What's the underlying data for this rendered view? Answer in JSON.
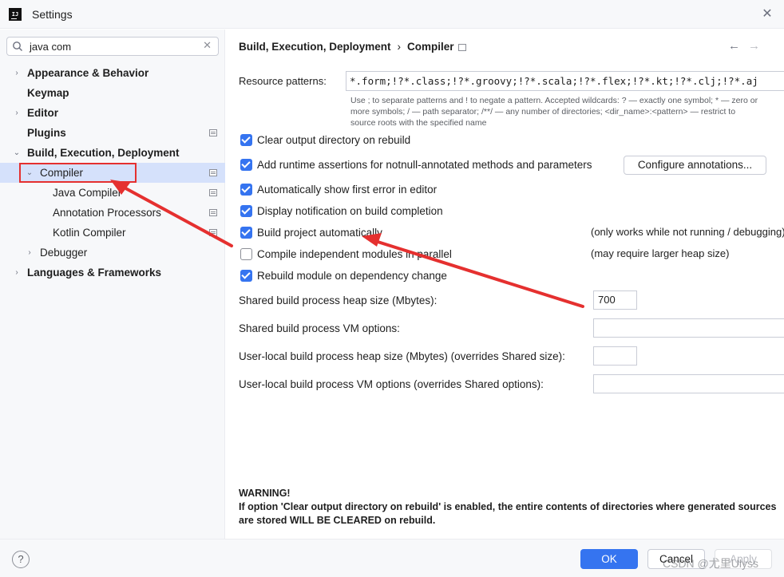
{
  "window": {
    "title": "Settings",
    "app_icon_text": "IJ",
    "close_icon": "close-icon"
  },
  "sidebar": {
    "search_value": "java com",
    "items": [
      {
        "label": "Appearance & Behavior",
        "expandable": true,
        "expanded": false
      },
      {
        "label": "Keymap"
      },
      {
        "label": "Editor",
        "expandable": true,
        "expanded": false
      },
      {
        "label": "Plugins"
      },
      {
        "label": "Build, Execution, Deployment",
        "expandable": true,
        "expanded": true
      },
      {
        "label": "Compiler",
        "expandable": true,
        "expanded": true,
        "selected": true
      },
      {
        "label": "Java Compiler"
      },
      {
        "label": "Annotation Processors"
      },
      {
        "label": "Kotlin Compiler"
      },
      {
        "label": "Debugger",
        "expandable": true,
        "expanded": false
      },
      {
        "label": "Languages & Frameworks",
        "expandable": true,
        "expanded": false
      }
    ]
  },
  "breadcrumb": {
    "parent": "Build, Execution, Deployment",
    "separator": "›",
    "current": "Compiler"
  },
  "resource_patterns": {
    "label": "Resource patterns:",
    "value": "*.form;!?*.class;!?*.groovy;!?*.scala;!?*.flex;!?*.kt;!?*.clj;!?*.aj",
    "hint_line1": "Use ; to separate patterns and ! to negate a pattern. Accepted wildcards: ? — exactly one symbol; * — zero or",
    "hint_line2": "more symbols; / — path separator; /**/ — any number of directories; <dir_name>:<pattern> — restrict to",
    "hint_line3": "source roots with the specified name"
  },
  "options": [
    {
      "label": "Clear output directory on rebuild",
      "checked": true
    },
    {
      "label": "Add runtime assertions for notnull-annotated methods and parameters",
      "checked": true
    },
    {
      "label": "Automatically show first error in editor",
      "checked": true
    },
    {
      "label": "Display notification on build completion",
      "checked": true
    },
    {
      "label": "Build project automatically",
      "checked": true,
      "note": "(only works while not running / debugging)"
    },
    {
      "label": "Compile independent modules in parallel",
      "checked": false,
      "note": "(may require larger heap size)"
    },
    {
      "label": "Rebuild module on dependency change",
      "checked": true
    }
  ],
  "configure_annotations_label": "Configure annotations...",
  "fields": [
    {
      "label": "Shared build process heap size (Mbytes):",
      "value": "700"
    },
    {
      "label": "Shared build process VM options:",
      "value": ""
    },
    {
      "label": "User-local build process heap size (Mbytes) (overrides Shared size):",
      "value": ""
    },
    {
      "label": "User-local build process VM options (overrides Shared options):",
      "value": ""
    }
  ],
  "warning": {
    "title": "WARNING!",
    "text": "If option 'Clear output directory on rebuild' is enabled, the entire contents of directories where generated sources are stored WILL BE CLEARED on rebuild."
  },
  "footer": {
    "help": "?",
    "ok": "OK",
    "cancel": "Cancel",
    "apply": "Apply",
    "watermark": "CSDN @尤里Ulyss"
  },
  "colors": {
    "accent": "#3574f0",
    "selection": "#d5e1fb",
    "annotation": "#e5302f"
  }
}
